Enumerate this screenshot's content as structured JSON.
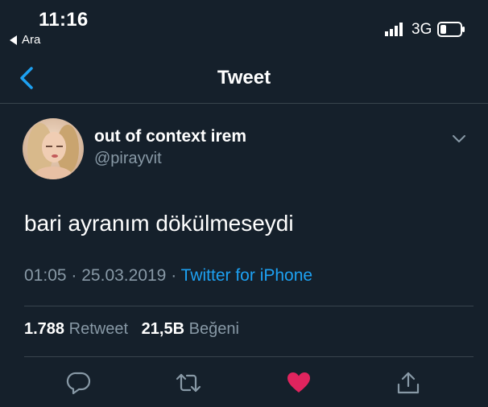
{
  "status_bar": {
    "time": "11:16",
    "back_app_label": "Ara",
    "network": "3G"
  },
  "nav": {
    "title": "Tweet"
  },
  "tweet": {
    "display_name": "out of context irem",
    "handle": "@pirayvit",
    "text": "bari ayranım dökülmeseydi",
    "time": "01:05",
    "separator": "·",
    "date": "25.03.2019",
    "source": "Twitter for iPhone",
    "retweet_count": "1.788",
    "retweet_label": "Retweet",
    "like_count": "21,5B",
    "like_label": "Beğeni"
  },
  "icons": {
    "reply": "reply-icon",
    "retweet": "retweet-icon",
    "like": "heart-icon",
    "share": "share-icon"
  },
  "colors": {
    "background": "#15202b",
    "accent": "#1da1f2",
    "like": "#e0245e",
    "muted": "#8899a6",
    "divider": "#38444d"
  }
}
